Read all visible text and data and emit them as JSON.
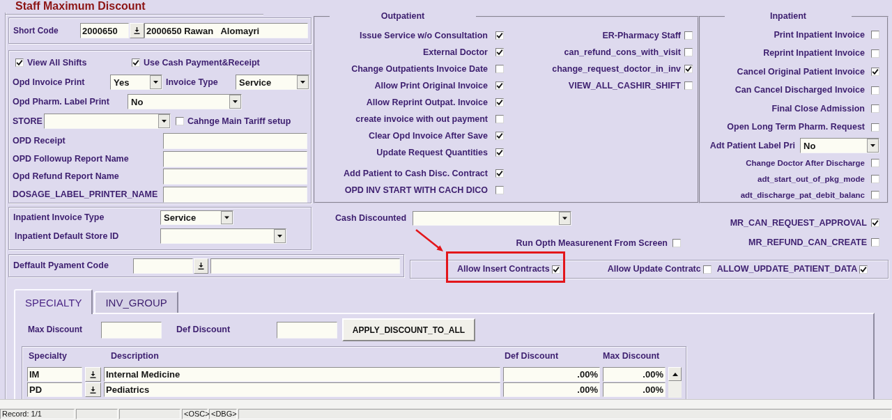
{
  "title": "Staff Maximum Discount",
  "short_code": {
    "label": "Short Code",
    "code": "2000650",
    "name": "2000650 Rawan   Alomayri"
  },
  "general": {
    "checks": [
      {
        "label": "View All Shifts",
        "checked": true
      },
      {
        "label": "Use Cash Payment&Receipt",
        "checked": true
      }
    ],
    "opd_invoice_print": {
      "label": "Opd Invoice Print",
      "value": "Yes"
    },
    "invoice_type": {
      "label": "Invoice Type",
      "value": "Service"
    },
    "opd_pharm_label_print": {
      "label": "Opd Pharm. Label Print",
      "value": "No"
    },
    "store": {
      "label": "STORE"
    },
    "change_main_tariff": {
      "label": "Cahnge Main Tariff setup",
      "checked": false
    },
    "report_fields": [
      {
        "label": "OPD Receipt"
      },
      {
        "label": "OPD Followup Report Name"
      },
      {
        "label": "Opd Refund Report Name"
      },
      {
        "label": "DOSAGE_LABEL_PRINTER_NAME"
      }
    ]
  },
  "outpatient": {
    "title": "Outpatient",
    "left_checks": [
      {
        "label": "Issue Service w/o Consultation",
        "checked": true
      },
      {
        "label": "External Doctor",
        "checked": true
      },
      {
        "label": "Change Outpatients Invoice Date",
        "checked": false
      },
      {
        "label": "Allow Print Original Invoice",
        "checked": true
      },
      {
        "label": "Allow Reprint Outpat. Invoice",
        "checked": true
      },
      {
        "label": "create invoice with out payment",
        "checked": false
      },
      {
        "label": "Clear Opd Invoice After Save",
        "checked": true
      },
      {
        "label": "Update Request Quantities",
        "checked": true
      },
      {
        "label": "Add Patient to Cash Disc. Contract",
        "checked": true
      },
      {
        "label": "OPD INV START WITH CACH DICO",
        "checked": false
      }
    ],
    "right_checks": [
      {
        "label": "ER-Pharmacy Staff",
        "checked": false
      },
      {
        "label": "can_refund_cons_with_visit",
        "checked": false
      },
      {
        "label": "change_request_doctor_in_inv",
        "checked": true
      },
      {
        "label": "VIEW_ALL_CASHIR_SHIFT",
        "checked": false
      }
    ]
  },
  "inpatient": {
    "title": "Inpatient",
    "items": [
      {
        "kind": "checkbox",
        "label": "Print Inpatient Invoice",
        "checked": false
      },
      {
        "kind": "checkbox",
        "label": "Reprint Inpatient Invoice",
        "checked": false
      },
      {
        "kind": "checkbox",
        "label": "Cancel Original Patient Invoice",
        "checked": true
      },
      {
        "kind": "checkbox",
        "label": "Can Cancel Discharged Invoice",
        "checked": false
      },
      {
        "kind": "checkbox",
        "label": "Final Close Admission",
        "checked": false
      },
      {
        "kind": "checkbox",
        "label": "Open Long Term Pharm. Request",
        "checked": false
      },
      {
        "kind": "select",
        "label": "Adt Patient Label Pri",
        "value": "No"
      },
      {
        "kind": "checkbox",
        "label": "Change Doctor After Discharge",
        "checked": false
      },
      {
        "kind": "checkbox",
        "label": "adt_start_out_of_pkg_mode",
        "checked": false
      },
      {
        "kind": "checkbox",
        "label": "adt_discharge_pat_debit_balanc",
        "checked": false
      }
    ]
  },
  "inpatient_settings": {
    "invoice_type": {
      "label": "Inpatient Invoice Type",
      "value": "Service"
    },
    "default_store": {
      "label": "Inpatient Default Store ID"
    }
  },
  "cash_discounted": {
    "label": "Cash Discounted"
  },
  "run_opth": {
    "label": "Run Opth Measurenent From Screen",
    "checked": false
  },
  "medical_records": [
    {
      "label": "MR_CAN_REQUEST_APPROVAL",
      "checked": true
    },
    {
      "label": "MR_REFUND_CAN_CREATE",
      "checked": false
    }
  ],
  "default_payment": {
    "label": "Deffault Pyament Code"
  },
  "contracts": [
    {
      "label": "Allow Insert Contracts",
      "checked": true,
      "highlighted": true
    },
    {
      "label": "Allow Update Contratc",
      "checked": false,
      "highlighted": false
    },
    {
      "label": "ALLOW_UPDATE_PATIENT_DATA",
      "checked": true,
      "highlighted": false
    }
  ],
  "tabs": [
    {
      "label": "SPECIALTY",
      "selected": true
    },
    {
      "label": "INV_GROUP",
      "selected": false
    }
  ],
  "discount": {
    "max_label": "Max Discount",
    "def_label": "Def Discount",
    "apply_button": "APPLY_DISCOUNT_TO_ALL"
  },
  "table": {
    "columns": [
      "Specialty",
      "Description",
      "Def Discount",
      "Max Discount"
    ],
    "rows": [
      {
        "specialty": "IM",
        "description": "Internal Medicine",
        "def_discount": ".00%",
        "max_discount": ".00%"
      },
      {
        "specialty": "PD",
        "description": "Pediatrics",
        "def_discount": ".00%",
        "max_discount": ".00%"
      }
    ]
  },
  "status_bar": {
    "record": "Record: 1/1",
    "flags": [
      "<OSC>",
      "<DBG>"
    ]
  }
}
